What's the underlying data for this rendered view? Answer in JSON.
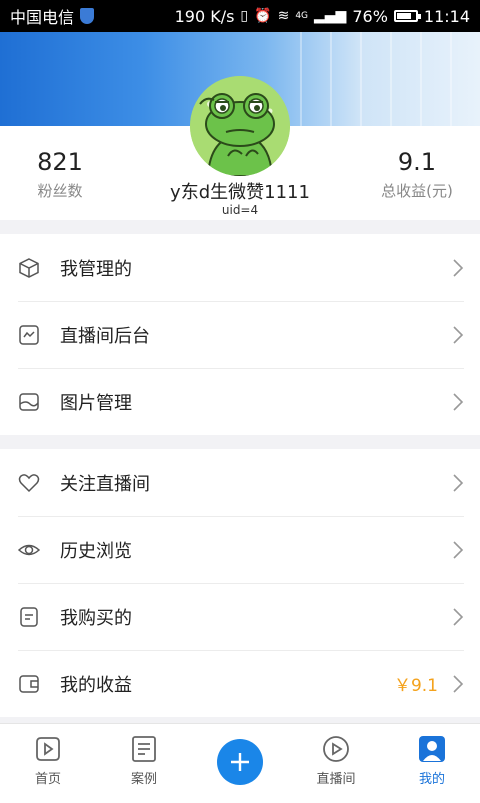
{
  "status_bar": {
    "carrier": "中国电信",
    "speed": "190 K/s",
    "network": "4G",
    "battery": "76%",
    "battery_level": 0.76,
    "time": "11:14"
  },
  "profile": {
    "fans_count": "821",
    "fans_label": "粉丝数",
    "name": "y东d生微赞1111",
    "uid": "uid=4",
    "income_value": "9.1",
    "income_label": "总收益(元)"
  },
  "menu_group_1": [
    {
      "label": "我管理的",
      "icon": "cube-icon"
    },
    {
      "label": "直播间后台",
      "icon": "monitor-wave-icon"
    },
    {
      "label": "图片管理",
      "icon": "image-icon"
    }
  ],
  "menu_group_2": [
    {
      "label": "关注直播间",
      "icon": "heart-icon"
    },
    {
      "label": "历史浏览",
      "icon": "eye-icon"
    },
    {
      "label": "我购买的",
      "icon": "receipt-icon"
    },
    {
      "label": "我的收益",
      "icon": "wallet-icon",
      "value": "￥9.1"
    }
  ],
  "bottom_nav": [
    {
      "label": "首页",
      "icon": "play-square-icon"
    },
    {
      "label": "案例",
      "icon": "document-icon"
    },
    {
      "label": "",
      "icon": "plus-icon"
    },
    {
      "label": "直播间",
      "icon": "play-circle-icon"
    },
    {
      "label": "我的",
      "icon": "user-icon",
      "active": true
    }
  ],
  "colors": {
    "accent": "#1a86e8",
    "income": "#f4a21c"
  }
}
